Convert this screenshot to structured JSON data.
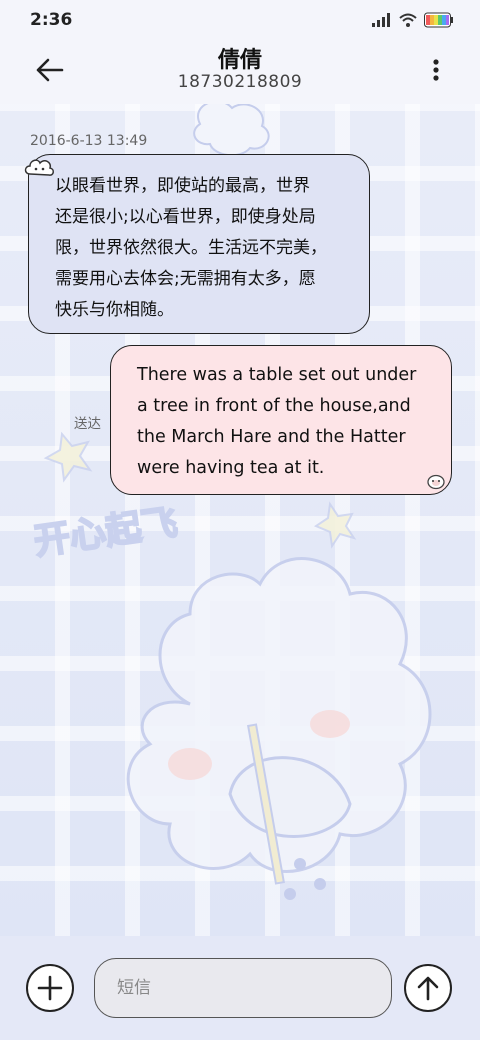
{
  "status_bar": {
    "time": "2:36",
    "icons": [
      "signal-icon",
      "wifi-icon",
      "battery-icon"
    ]
  },
  "header": {
    "contact_name": "倩倩",
    "contact_number": "18730218809",
    "back_icon": "back-arrow-icon",
    "more_icon": "more-vert-icon"
  },
  "conversation": {
    "timestamp": "2016-6-13 13:49",
    "messages": [
      {
        "direction": "incoming",
        "text": "以眼看世界，即使站的最高，世界\n还是很小;以心看世界，即使身处局\n限，世界依然很大。生活远不完美，\n需要用心去体会;无需拥有太多，愿\n快乐与你相随。"
      },
      {
        "direction": "outgoing",
        "text": "There was a table set out under\na tree in front of the house,and\nthe March Hare and the Hatter\nwere having tea at it.",
        "status": "送达"
      }
    ]
  },
  "wallpaper": {
    "caption": "开心起飞"
  },
  "compose": {
    "placeholder": "短信",
    "value": "",
    "add_icon": "plus-icon",
    "send_icon": "send-arrow-icon"
  },
  "colors": {
    "incoming_bubble": "#dfe3f4",
    "outgoing_bubble": "#fde4e7",
    "background": "#eef1fb"
  }
}
